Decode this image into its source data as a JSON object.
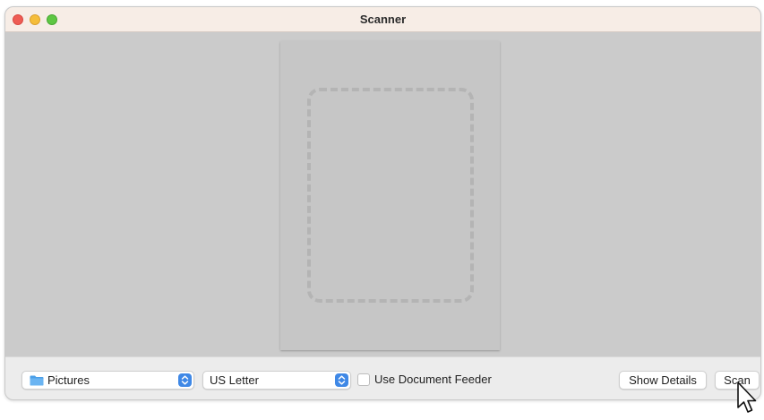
{
  "window": {
    "title": "Scanner"
  },
  "toolbar": {
    "destination": {
      "label": "Pictures",
      "icon": "folder-icon"
    },
    "size": {
      "label": "US Letter"
    },
    "feeder": {
      "label": "Use Document Feeder",
      "checked": false
    },
    "show_details_label": "Show Details",
    "scan_label": "Scan"
  },
  "colors": {
    "accent": "#3f88e6",
    "close": "#ee5c54",
    "minimize": "#f5bd3a",
    "maximize": "#5ec743"
  }
}
